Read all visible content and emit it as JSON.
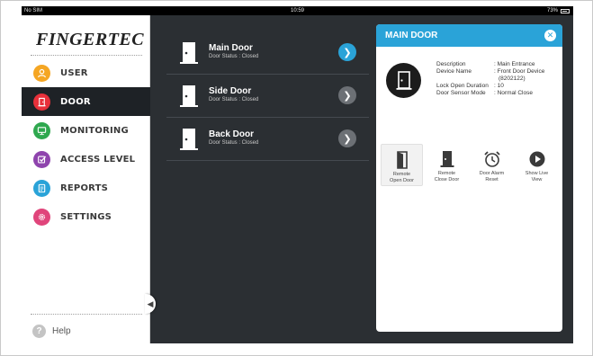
{
  "status_bar": {
    "carrier": "No SIM",
    "time": "10:59",
    "battery": "73%"
  },
  "app": {
    "logo_text": "FINGERTEC"
  },
  "sidebar": {
    "items": [
      {
        "label": "USER",
        "icon": "user-icon",
        "color": "#f5a623",
        "active": false
      },
      {
        "label": "DOOR",
        "icon": "door-icon",
        "color": "#e8303a",
        "active": true
      },
      {
        "label": "MONITORING",
        "icon": "monitor-icon",
        "color": "#2fa84f",
        "active": false
      },
      {
        "label": "ACCESS LEVEL",
        "icon": "checkmark-icon",
        "color": "#8e44ad",
        "active": false
      },
      {
        "label": "REPORTS",
        "icon": "document-icon",
        "color": "#2aa3d8",
        "active": false
      },
      {
        "label": "SETTINGS",
        "icon": "gear-icon",
        "color": "#e0457b",
        "active": false
      }
    ],
    "help_label": "Help",
    "help_icon": "question-icon"
  },
  "doors": [
    {
      "name": "Main Door",
      "status": "Door Status : Closed",
      "selected": true
    },
    {
      "name": "Side Door",
      "status": "Door Status : Closed",
      "selected": false
    },
    {
      "name": "Back Door",
      "status": "Door Status : Closed",
      "selected": false
    }
  ],
  "panel": {
    "title": "MAIN DOOR",
    "details": [
      {
        "key": "Description",
        "value": ": Main Entrance"
      },
      {
        "key": "Device Name",
        "value": ": Front Door Device"
      },
      {
        "key": "",
        "value": "(8202122)"
      },
      {
        "key": "Lock Open Duration",
        "value": ": 10"
      },
      {
        "key": "Door Sensor Mode",
        "value": ": Normal Close"
      }
    ],
    "actions": [
      {
        "label_line1": "Remote",
        "label_line2": "Open Door",
        "icon": "open-door-icon"
      },
      {
        "label_line1": "Remote",
        "label_line2": "Close Door",
        "icon": "close-door-icon"
      },
      {
        "label_line1": "Door Alarm",
        "label_line2": "Reset",
        "icon": "alarm-clock-icon"
      },
      {
        "label_line1": "Show Live",
        "label_line2": "View",
        "icon": "play-icon"
      }
    ]
  },
  "colors": {
    "accent": "#2aa3d8",
    "sidebar_active": "#1e2226",
    "background": "#2b2f33"
  }
}
